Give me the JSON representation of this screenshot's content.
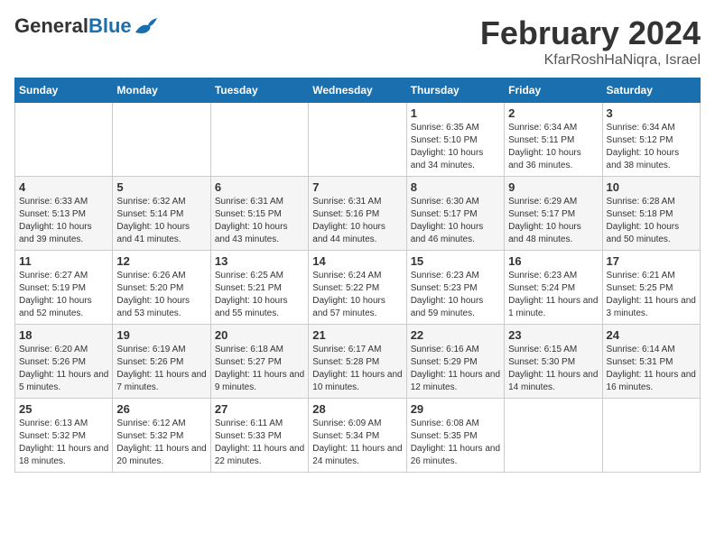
{
  "header": {
    "logo_general": "General",
    "logo_blue": "Blue",
    "title": "February 2024",
    "location": "KfarRoshHaNiqra, Israel"
  },
  "days_of_week": [
    "Sunday",
    "Monday",
    "Tuesday",
    "Wednesday",
    "Thursday",
    "Friday",
    "Saturday"
  ],
  "weeks": [
    [
      {
        "day": "",
        "info": ""
      },
      {
        "day": "",
        "info": ""
      },
      {
        "day": "",
        "info": ""
      },
      {
        "day": "",
        "info": ""
      },
      {
        "day": "1",
        "info": "Sunrise: 6:35 AM\nSunset: 5:10 PM\nDaylight: 10 hours\nand 34 minutes."
      },
      {
        "day": "2",
        "info": "Sunrise: 6:34 AM\nSunset: 5:11 PM\nDaylight: 10 hours\nand 36 minutes."
      },
      {
        "day": "3",
        "info": "Sunrise: 6:34 AM\nSunset: 5:12 PM\nDaylight: 10 hours\nand 38 minutes."
      }
    ],
    [
      {
        "day": "4",
        "info": "Sunrise: 6:33 AM\nSunset: 5:13 PM\nDaylight: 10 hours\nand 39 minutes."
      },
      {
        "day": "5",
        "info": "Sunrise: 6:32 AM\nSunset: 5:14 PM\nDaylight: 10 hours\nand 41 minutes."
      },
      {
        "day": "6",
        "info": "Sunrise: 6:31 AM\nSunset: 5:15 PM\nDaylight: 10 hours\nand 43 minutes."
      },
      {
        "day": "7",
        "info": "Sunrise: 6:31 AM\nSunset: 5:16 PM\nDaylight: 10 hours\nand 44 minutes."
      },
      {
        "day": "8",
        "info": "Sunrise: 6:30 AM\nSunset: 5:17 PM\nDaylight: 10 hours\nand 46 minutes."
      },
      {
        "day": "9",
        "info": "Sunrise: 6:29 AM\nSunset: 5:17 PM\nDaylight: 10 hours\nand 48 minutes."
      },
      {
        "day": "10",
        "info": "Sunrise: 6:28 AM\nSunset: 5:18 PM\nDaylight: 10 hours\nand 50 minutes."
      }
    ],
    [
      {
        "day": "11",
        "info": "Sunrise: 6:27 AM\nSunset: 5:19 PM\nDaylight: 10 hours\nand 52 minutes."
      },
      {
        "day": "12",
        "info": "Sunrise: 6:26 AM\nSunset: 5:20 PM\nDaylight: 10 hours\nand 53 minutes."
      },
      {
        "day": "13",
        "info": "Sunrise: 6:25 AM\nSunset: 5:21 PM\nDaylight: 10 hours\nand 55 minutes."
      },
      {
        "day": "14",
        "info": "Sunrise: 6:24 AM\nSunset: 5:22 PM\nDaylight: 10 hours\nand 57 minutes."
      },
      {
        "day": "15",
        "info": "Sunrise: 6:23 AM\nSunset: 5:23 PM\nDaylight: 10 hours\nand 59 minutes."
      },
      {
        "day": "16",
        "info": "Sunrise: 6:23 AM\nSunset: 5:24 PM\nDaylight: 11 hours\nand 1 minute."
      },
      {
        "day": "17",
        "info": "Sunrise: 6:21 AM\nSunset: 5:25 PM\nDaylight: 11 hours\nand 3 minutes."
      }
    ],
    [
      {
        "day": "18",
        "info": "Sunrise: 6:20 AM\nSunset: 5:26 PM\nDaylight: 11 hours\nand 5 minutes."
      },
      {
        "day": "19",
        "info": "Sunrise: 6:19 AM\nSunset: 5:26 PM\nDaylight: 11 hours\nand 7 minutes."
      },
      {
        "day": "20",
        "info": "Sunrise: 6:18 AM\nSunset: 5:27 PM\nDaylight: 11 hours\nand 9 minutes."
      },
      {
        "day": "21",
        "info": "Sunrise: 6:17 AM\nSunset: 5:28 PM\nDaylight: 11 hours\nand 10 minutes."
      },
      {
        "day": "22",
        "info": "Sunrise: 6:16 AM\nSunset: 5:29 PM\nDaylight: 11 hours\nand 12 minutes."
      },
      {
        "day": "23",
        "info": "Sunrise: 6:15 AM\nSunset: 5:30 PM\nDaylight: 11 hours\nand 14 minutes."
      },
      {
        "day": "24",
        "info": "Sunrise: 6:14 AM\nSunset: 5:31 PM\nDaylight: 11 hours\nand 16 minutes."
      }
    ],
    [
      {
        "day": "25",
        "info": "Sunrise: 6:13 AM\nSunset: 5:32 PM\nDaylight: 11 hours\nand 18 minutes."
      },
      {
        "day": "26",
        "info": "Sunrise: 6:12 AM\nSunset: 5:32 PM\nDaylight: 11 hours\nand 20 minutes."
      },
      {
        "day": "27",
        "info": "Sunrise: 6:11 AM\nSunset: 5:33 PM\nDaylight: 11 hours\nand 22 minutes."
      },
      {
        "day": "28",
        "info": "Sunrise: 6:09 AM\nSunset: 5:34 PM\nDaylight: 11 hours\nand 24 minutes."
      },
      {
        "day": "29",
        "info": "Sunrise: 6:08 AM\nSunset: 5:35 PM\nDaylight: 11 hours\nand 26 minutes."
      },
      {
        "day": "",
        "info": ""
      },
      {
        "day": "",
        "info": ""
      }
    ]
  ]
}
